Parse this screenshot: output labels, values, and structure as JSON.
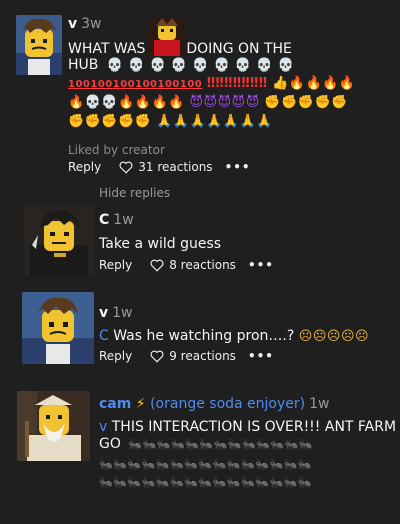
{
  "comments": [
    {
      "name": "v",
      "time": "3w",
      "text_line1": "WHAT WAS",
      "text_line1b": "DOING ON THE",
      "text_line2": "HUB",
      "liked": "Liked by creator",
      "reply": "Reply",
      "reactions": "31 reactions",
      "more": "•••"
    },
    {
      "name": "C",
      "time": "1w",
      "text": "Take a wild guess",
      "reply": "Reply",
      "reactions": "8 reactions",
      "more": "•••"
    },
    {
      "name": "v",
      "time": "1w",
      "mention": "C",
      "text": "Was he watching pron….?",
      "reply": "Reply",
      "reactions": "9 reactions",
      "more": "•••"
    },
    {
      "name": "cam",
      "flair": "(orange soda enjoyer)",
      "time": "1w",
      "mention": "v",
      "text_line1": "THIS INTERACTION IS OVER!!! ANT FARM",
      "text_line2": "GO"
    }
  ],
  "hide_replies": "Hide replies",
  "colors": {
    "background": "#1f1f1f",
    "mention": "#4e8cf2",
    "muted": "#9a9a9a"
  }
}
